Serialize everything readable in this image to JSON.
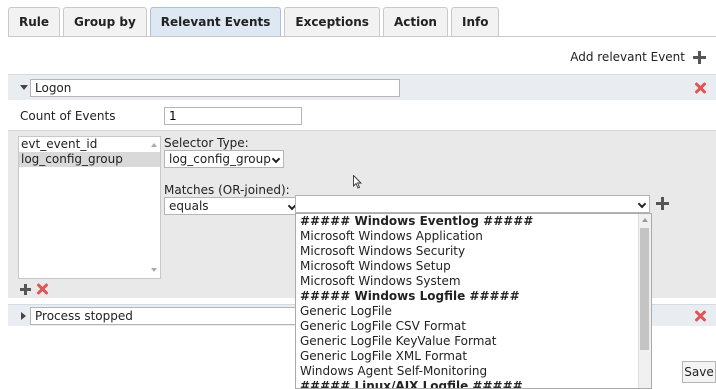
{
  "tabs": [
    {
      "label": "Rule"
    },
    {
      "label": "Group by"
    },
    {
      "label": "Relevant Events"
    },
    {
      "label": "Exceptions"
    },
    {
      "label": "Action"
    },
    {
      "label": "Info"
    }
  ],
  "add_relevant_event_label": "Add relevant Event",
  "event": {
    "name": "Logon",
    "count_label": "Count of Events",
    "count_value": "1",
    "fields": [
      "evt_event_id",
      "log_config_group"
    ],
    "selector_type_label": "Selector Type:",
    "selector_type_value": "log_config_group",
    "matches_label": "Matches (OR-joined):",
    "match_operator": "equals",
    "match_value": ""
  },
  "dropdown_options": [
    {
      "label": "##### Windows Eventlog #####",
      "group": true
    },
    {
      "label": "Microsoft Windows Application",
      "group": false
    },
    {
      "label": "Microsoft Windows Security",
      "group": false
    },
    {
      "label": "Microsoft Windows Setup",
      "group": false
    },
    {
      "label": "Microsoft Windows System",
      "group": false
    },
    {
      "label": "##### Windows Logfile #####",
      "group": true
    },
    {
      "label": "Generic LogFile",
      "group": false
    },
    {
      "label": "Generic LogFile CSV Format",
      "group": false
    },
    {
      "label": "Generic LogFile KeyValue Format",
      "group": false
    },
    {
      "label": "Generic LogFile XML Format",
      "group": false
    },
    {
      "label": "Windows Agent Self-Monitoring",
      "group": false
    },
    {
      "label": "##### Linux/AIX Logfile #####",
      "group": true
    }
  ],
  "second_event": {
    "name": "Process stopped"
  },
  "save_label": "Save"
}
